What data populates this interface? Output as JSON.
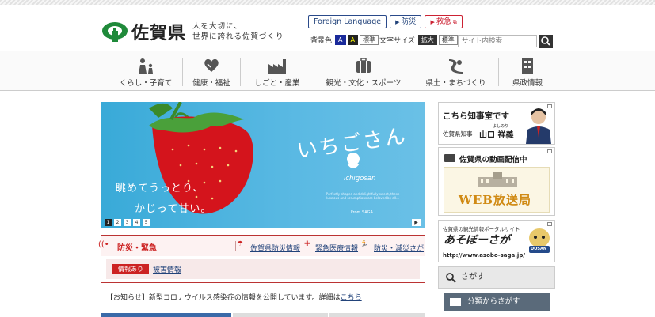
{
  "header": {
    "logo_text": "佐賀県",
    "tagline_line1": "人を大切に、",
    "tagline_line2": "世界に誇れる佐賀づくり",
    "foreign_language": "Foreign Language",
    "bousai_link": "防災",
    "emergency_link": "救急",
    "bgcolor_label": "背景色",
    "bg_blue": "A",
    "bg_yellow": "A",
    "bg_standard": "標準",
    "fontsize_label": "文字サイズ",
    "font_large": "拡大",
    "font_standard": "標準",
    "search_placeholder": "サイト内検索"
  },
  "nav": {
    "items": [
      {
        "label": "くらし・子育て",
        "icon": "family-icon"
      },
      {
        "label": "健康・福祉",
        "icon": "heart-hands-icon"
      },
      {
        "label": "しごと・産業",
        "icon": "factory-icon"
      },
      {
        "label": "観光・文化・スポーツ",
        "icon": "suitcase-icon"
      },
      {
        "label": "県土・まちづくり",
        "icon": "road-icon"
      },
      {
        "label": "県政情報",
        "icon": "building-icon"
      }
    ]
  },
  "hero": {
    "catch1": "眺めてうっとり、",
    "catch2": "かじって甘い。",
    "brand": "いちごさん",
    "romaji": "ichigosan",
    "small_text": "Perfectly shaped and delightfully sweet, these luscious and scrumptious are beloved by all...",
    "from": "From SAGA",
    "slides": [
      "1",
      "2",
      "3",
      "4",
      "5"
    ],
    "play_icon": "play-icon"
  },
  "bousai": {
    "title": "防災・緊急",
    "links": [
      "佐賀県防災情報",
      "緊急医療情報",
      "防災・減災さが"
    ],
    "badge": "情報あり",
    "damage_link": "被害情報"
  },
  "notice": {
    "prefix": "【お知らせ】新型コロナウイルス感染症の情報を公開しています。詳細は",
    "link": "こちら"
  },
  "sidebar": {
    "governor_title": "こちら知事室です",
    "governor_sub": "佐賀県知事",
    "governor_ruby": "よしのり",
    "governor_name": "山口 祥義",
    "video_label": "佐賀県の動画配信中",
    "web_broadcast": "WEB放送局",
    "portal_caption": "佐賀県の観光情報ポータルサイト",
    "asobo_title": "あそぼーさが",
    "asobo_url": "http://www.asobo-saga.jp/",
    "dosan": "DOSAN",
    "search_title": "さがす",
    "category_search": "分類からさがす"
  },
  "colors": {
    "brand_green": "#2a8a2a",
    "accent_red": "#c22222",
    "link_blue": "#22437a",
    "hero_sky": "#4ab3de"
  }
}
